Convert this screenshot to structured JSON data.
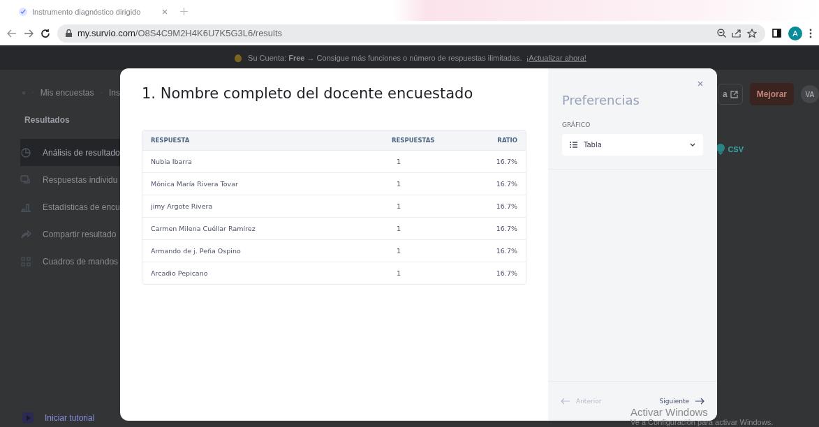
{
  "browser": {
    "tab_title": "Instrumento diagnóstico dirigido",
    "url_host": "my.survio.com",
    "url_path": "/O8S4C9M2H4K6U7K5G3L6/results",
    "profile": "A"
  },
  "banner": {
    "text": "Su Cuenta: **Free** → Consigue más funciones o número de respuestas ilimitadas.",
    "link": "¡Actualizar ahora!"
  },
  "page": {
    "breadcrumb": [
      "Mis encuestas",
      "Ins"
    ],
    "section": "Resultados",
    "sidebar": [
      {
        "label": "Análisis de resultado",
        "selected": true
      },
      {
        "label": "Respuestas individu",
        "selected": false
      },
      {
        "label": "Estadísticas de encu",
        "selected": false
      },
      {
        "label": "Compartir resultado",
        "selected": false
      },
      {
        "label": "Cuadros de mandos",
        "selected": false
      }
    ],
    "tutorial": "Iniciar tutorial",
    "link_tail": "a",
    "upgrade": "Mejorar",
    "avatar": "VA",
    "export": "CSV"
  },
  "modal": {
    "title": "1. Nombre completo del docente encuestado",
    "table": {
      "columns": [
        "RESPUESTA",
        "RESPUESTAS",
        "RATIO"
      ],
      "rows": [
        [
          "Nubia Ibarra",
          "1",
          "16.7%"
        ],
        [
          "Mónica María Rivera Tovar",
          "1",
          "16.7%"
        ],
        [
          "jimy Argote Rivera",
          "1",
          "16.7%"
        ],
        [
          "Carmen Milena Cuéllar Ramírez",
          "1",
          "16.7%"
        ],
        [
          "Armando de j. Peña Ospino",
          "1",
          "16.7%"
        ],
        [
          "Arcadio Pepicano",
          "1",
          "16.7%"
        ]
      ]
    },
    "preferences": {
      "title": "Preferencias",
      "chart_label": "GRÁFICO",
      "chart_type": "Tabla"
    },
    "prev": {
      "label": "Anterior",
      "disabled": true
    },
    "next": {
      "label": "Siguiente",
      "disabled": false
    }
  },
  "os_notice": {
    "title": "Activar Windows",
    "text": "Ve a Configuración para activar Windows."
  }
}
